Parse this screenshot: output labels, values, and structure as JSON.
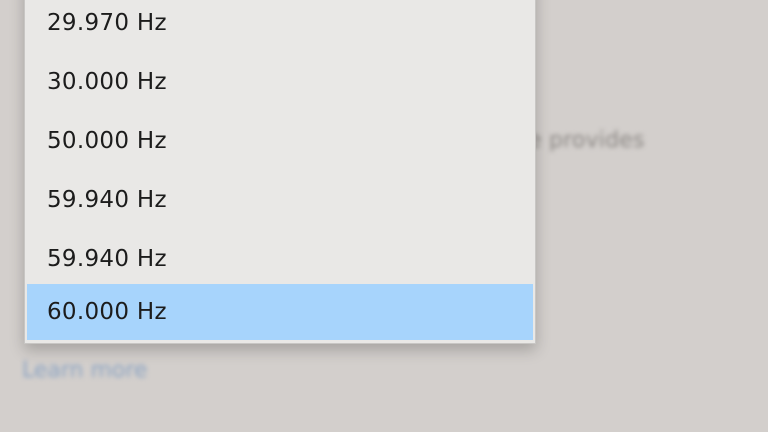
{
  "background": {
    "description_fragment": "her rate provides",
    "learn_more_link": "Learn more"
  },
  "dropdown": {
    "options": [
      {
        "label": "29.970 Hz",
        "selected": false
      },
      {
        "label": "30.000 Hz",
        "selected": false
      },
      {
        "label": "50.000 Hz",
        "selected": false
      },
      {
        "label": "59.940 Hz",
        "selected": false
      },
      {
        "label": "59.940 Hz",
        "selected": false
      },
      {
        "label": "60.000 Hz",
        "selected": true
      }
    ]
  },
  "colors": {
    "selected_highlight": "#a7d4fc",
    "link": "#8ba3c2"
  }
}
